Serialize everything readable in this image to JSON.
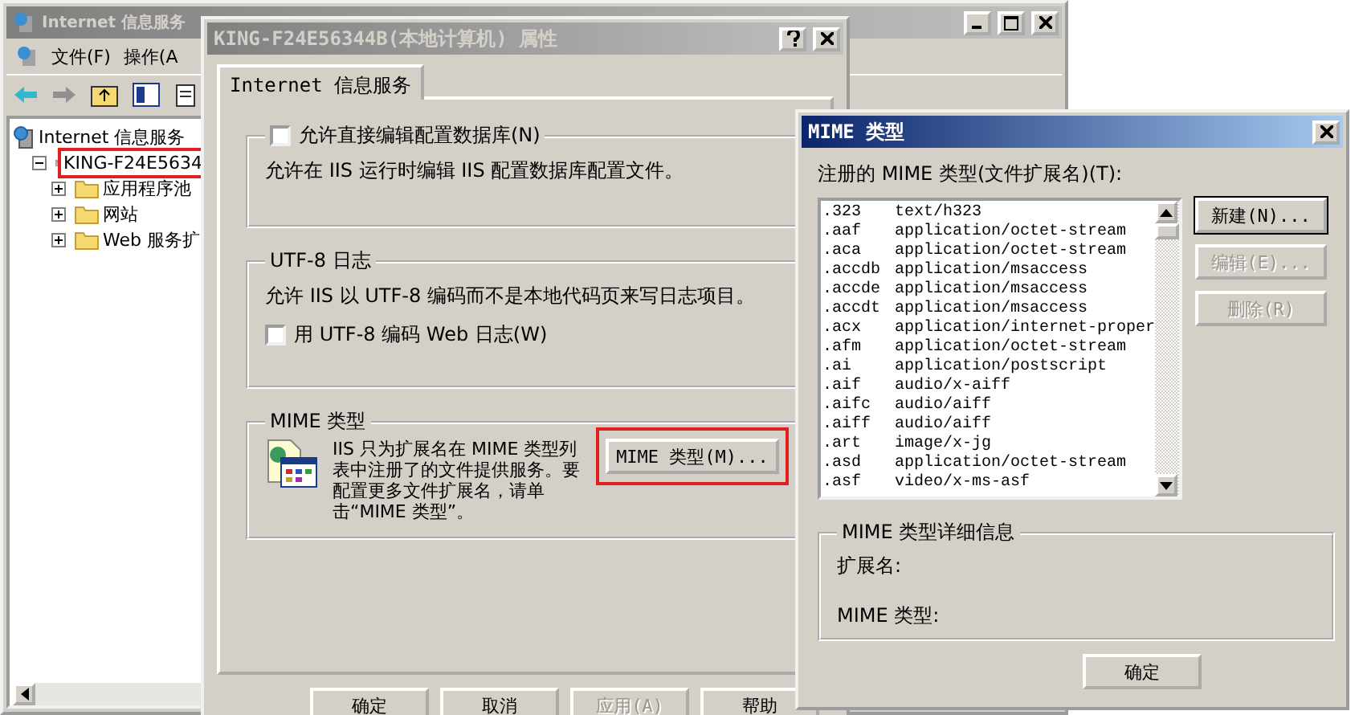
{
  "mmc": {
    "title": "Internet 信息服务",
    "menu": [
      "文件(F)",
      "操作(A"
    ],
    "tree": [
      {
        "label": "Internet 信息服务",
        "kind": "service",
        "children": [
          {
            "label": "KING-F24E5634",
            "kind": "server",
            "expanded": true,
            "children": [
              {
                "label": "应用程序池",
                "kind": "folder",
                "expanded": false
              },
              {
                "label": "网站",
                "kind": "folder",
                "expanded": false
              },
              {
                "label": "Web 服务扩",
                "kind": "folder",
                "expanded": false
              }
            ]
          }
        ]
      }
    ]
  },
  "properties": {
    "title": "KING-F24E56344B(本地计算机) 属性",
    "tabs": [
      {
        "label": "Internet 信息服务",
        "selected": true
      }
    ],
    "edit_group": {
      "checkbox": {
        "label": "允许直接编辑配置数据库(N)",
        "checked": false
      },
      "text": "允许在 IIS 运行时编辑 IIS 配置数据库配置文件。"
    },
    "utf8_group": {
      "title": "UTF-8 日志",
      "text": "允许 IIS 以 UTF-8 编码而不是本地代码页来写日志项目。",
      "checkbox": {
        "label": "用 UTF-8 编码 Web 日志(W)",
        "checked": false
      }
    },
    "mime_group": {
      "title": "MIME 类型",
      "text": "IIS 只为扩展名在 MIME 类型列表中注册了的文件提供服务。要配置更多文件扩展名，请单击“MIME 类型”。",
      "button": "MIME 类型(M)..."
    },
    "buttons": [
      {
        "label": "确定",
        "disabled": false
      },
      {
        "label": "取消",
        "disabled": false
      },
      {
        "label": "应用(A)",
        "disabled": true
      },
      {
        "label": "帮助",
        "disabled": false
      }
    ]
  },
  "mime_dialog": {
    "title": "MIME 类型",
    "list_label": "注册的 MIME 类型(文件扩展名)(T):",
    "rows": [
      {
        "ext": ".323",
        "type": "text/h323"
      },
      {
        "ext": ".aaf",
        "type": "application/octet-stream"
      },
      {
        "ext": ".aca",
        "type": "application/octet-stream"
      },
      {
        "ext": ".accdb",
        "type": "application/msaccess"
      },
      {
        "ext": ".accde",
        "type": "application/msaccess"
      },
      {
        "ext": ".accdt",
        "type": "application/msaccess"
      },
      {
        "ext": ".acx",
        "type": "application/internet-proper"
      },
      {
        "ext": ".afm",
        "type": "application/octet-stream"
      },
      {
        "ext": ".ai",
        "type": "application/postscript"
      },
      {
        "ext": ".aif",
        "type": "audio/x-aiff"
      },
      {
        "ext": ".aifc",
        "type": "audio/aiff"
      },
      {
        "ext": ".aiff",
        "type": "audio/aiff"
      },
      {
        "ext": ".art",
        "type": "image/x-jg"
      },
      {
        "ext": ".asd",
        "type": "application/octet-stream"
      },
      {
        "ext": ".asf",
        "type": "video/x-ms-asf"
      }
    ],
    "buttons": [
      {
        "label": "新建(N)...",
        "disabled": false
      },
      {
        "label": "编辑(E)...",
        "disabled": true
      },
      {
        "label": "删除(R)",
        "disabled": true
      }
    ],
    "details": {
      "title": "MIME 类型详细信息",
      "fields": [
        "扩展名:",
        "MIME 类型:"
      ]
    },
    "ok": "确定"
  }
}
